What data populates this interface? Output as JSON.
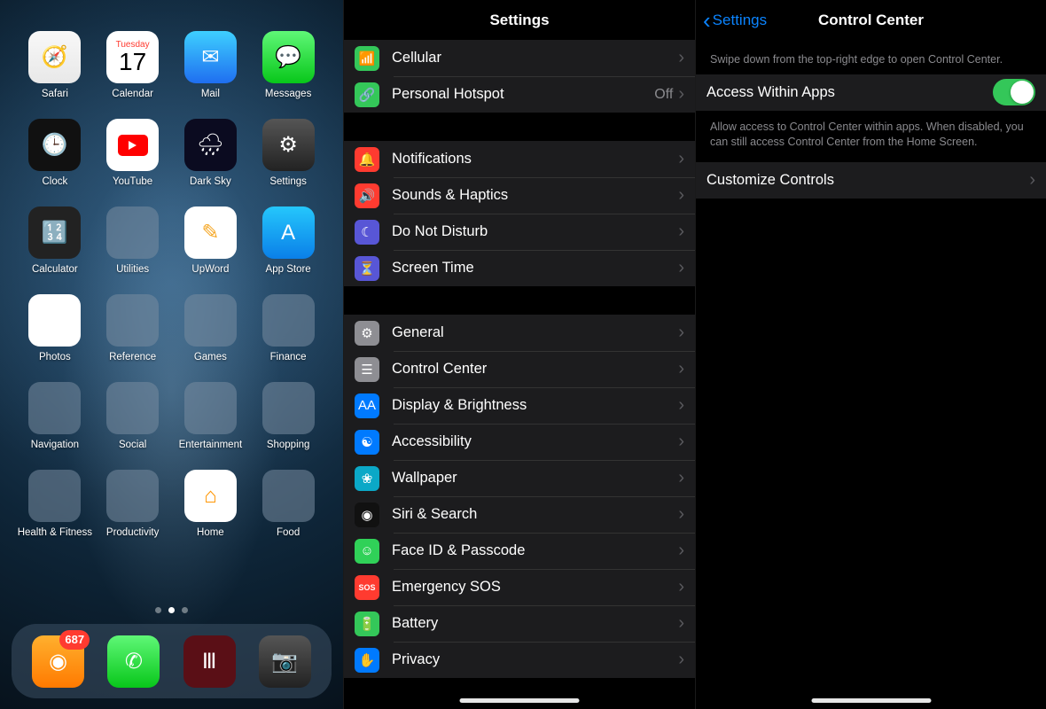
{
  "home": {
    "apps": [
      {
        "label": "Safari",
        "icon_bg": "bg-safari",
        "glyph": "🧭"
      },
      {
        "label": "Calendar",
        "icon_bg": "bg-cal",
        "day": "Tuesday",
        "num": "17"
      },
      {
        "label": "Mail",
        "icon_bg": "bg-mail",
        "glyph": "✉︎"
      },
      {
        "label": "Messages",
        "icon_bg": "bg-msg",
        "glyph": "💬"
      },
      {
        "label": "Clock",
        "icon_bg": "bg-clock",
        "glyph": "🕒"
      },
      {
        "label": "YouTube",
        "icon_bg": "bg-yt"
      },
      {
        "label": "Dark Sky",
        "icon_bg": "bg-dark",
        "glyph": "🌧"
      },
      {
        "label": "Settings",
        "icon_bg": "bg-set",
        "glyph": "⚙︎"
      },
      {
        "label": "Calculator",
        "icon_bg": "bg-calc",
        "glyph": "🔢"
      },
      {
        "label": "Utilities",
        "folder": true,
        "minis": [
          "#ff3b30",
          "#007aff",
          "#34c759",
          "#ff9500",
          "#5856d6",
          "#ffcc00",
          "#ff2d55",
          "#8e8e93",
          "#0ba8c7"
        ]
      },
      {
        "label": "UpWord",
        "icon_bg": "bg-upw",
        "glyph": "✎"
      },
      {
        "label": "App Store",
        "icon_bg": "bg-apps",
        "glyph": "A"
      },
      {
        "label": "Photos",
        "icon_bg": "bg-photos",
        "glyph": "❋"
      },
      {
        "label": "Reference",
        "folder": true,
        "minis": [
          "#ff9500",
          "#007aff",
          "#34c759",
          "#ff3b30",
          "#5856d6",
          "#ffcc00",
          "#ff2d55",
          "#0ba8c7",
          "#8e8e93"
        ]
      },
      {
        "label": "Games",
        "folder": true,
        "minis": [
          "#1c1c1e",
          "#1c1c1e",
          "#1c1c1e",
          "",
          "",
          "",
          "",
          "",
          ""
        ]
      },
      {
        "label": "Finance",
        "folder": true,
        "minis": [
          "#ff3b30",
          "#007aff",
          "#ffcc00",
          "#34c759",
          "#ff9500",
          "#0ba8c7",
          "#5856d6",
          "#ff2d55",
          "#8e8e93"
        ]
      },
      {
        "label": "Navigation",
        "folder": true,
        "minis": [
          "#34c759",
          "#007aff",
          "#ff9500",
          "#8e8e93",
          "#ff3b30",
          "#ffcc00",
          "",
          "",
          ""
        ]
      },
      {
        "label": "Social",
        "folder": true,
        "minis": [
          "#ff2d55",
          "#5856d6",
          "#ff9500",
          "#ffcc00",
          "#007aff",
          "#34c759",
          "#ff3b30",
          "#0ba8c7",
          "#8e8e93"
        ]
      },
      {
        "label": "Entertainment",
        "folder": true,
        "minis": [
          "#5856d6",
          "#007aff",
          "#ff3b30",
          "#ffcc00",
          "#34c759",
          "#ff9500",
          "#0ba8c7",
          "#ff2d55",
          "#8e8e93"
        ]
      },
      {
        "label": "Shopping",
        "folder": true,
        "minis": [
          "#ff3b30",
          "#ff9500",
          "#ffcc00",
          "#34c759",
          "#007aff",
          "#ff2d55",
          "#8e8e93",
          "#0ba8c7",
          "#5856d6"
        ]
      },
      {
        "label": "Health & Fitness",
        "folder": true,
        "minis": [
          "#ff3b30",
          "#ff2d55",
          "#007aff",
          "#ff9500",
          "#34c759",
          "#ffcc00",
          "#0ba8c7",
          "#8e8e93",
          "#5856d6"
        ]
      },
      {
        "label": "Productivity",
        "folder": true,
        "minis": [
          "#007aff",
          "#ff9500",
          "#8e8e93",
          "#34c759",
          "#ffcc00",
          "#ff3b30",
          "",
          "",
          ""
        ]
      },
      {
        "label": "Home",
        "icon_bg": "bg-home",
        "glyph": "⌂"
      },
      {
        "label": "Food",
        "folder": true,
        "minis": [
          "#ff3b30",
          "#ff9500",
          "#ffcc00",
          "",
          "",
          "",
          "",
          "",
          ""
        ]
      }
    ],
    "dock": [
      {
        "name": "overcast",
        "bg": "dock1",
        "glyph": "◉",
        "badge": "687"
      },
      {
        "name": "phone",
        "bg": "dock2",
        "glyph": "✆"
      },
      {
        "name": "marcus-theatres",
        "bg": "dock3",
        "glyph": "Ⅲ"
      },
      {
        "name": "camera",
        "bg": "dock4",
        "glyph": "📷"
      }
    ]
  },
  "settings": {
    "title": "Settings",
    "groups": [
      [
        {
          "label": "Cellular",
          "icon": "ic-green",
          "glyph": "📶"
        },
        {
          "label": "Personal Hotspot",
          "icon": "ic-green",
          "glyph": "🔗",
          "detail": "Off"
        }
      ],
      [
        {
          "label": "Notifications",
          "icon": "ic-red",
          "glyph": "🔔"
        },
        {
          "label": "Sounds & Haptics",
          "icon": "ic-red",
          "glyph": "🔊"
        },
        {
          "label": "Do Not Disturb",
          "icon": "ic-purple",
          "glyph": "☾"
        },
        {
          "label": "Screen Time",
          "icon": "ic-purple",
          "glyph": "⏳"
        }
      ],
      [
        {
          "label": "General",
          "icon": "ic-gray",
          "glyph": "⚙︎"
        },
        {
          "label": "Control Center",
          "icon": "ic-gray",
          "glyph": "☰"
        },
        {
          "label": "Display & Brightness",
          "icon": "ic-blue",
          "glyph": "AA"
        },
        {
          "label": "Accessibility",
          "icon": "ic-blue",
          "glyph": "☯"
        },
        {
          "label": "Wallpaper",
          "icon": "ic-cyan",
          "glyph": "❀"
        },
        {
          "label": "Siri & Search",
          "icon": "ic-black",
          "glyph": "◉"
        },
        {
          "label": "Face ID & Passcode",
          "icon": "ic-face",
          "glyph": "☺"
        },
        {
          "label": "Emergency SOS",
          "icon": "ic-red",
          "glyph": "SOS"
        },
        {
          "label": "Battery",
          "icon": "ic-green",
          "glyph": "🔋"
        },
        {
          "label": "Privacy",
          "icon": "ic-blue",
          "glyph": "✋"
        }
      ]
    ]
  },
  "cc": {
    "back": "Settings",
    "title": "Control Center",
    "swipe_hint": "Swipe down from the top-right edge to open Control Center.",
    "toggle_label": "Access Within Apps",
    "toggle_on": true,
    "toggle_footer": "Allow access to Control Center within apps. When disabled, you can still access Control Center from the Home Screen.",
    "customize": "Customize Controls"
  }
}
